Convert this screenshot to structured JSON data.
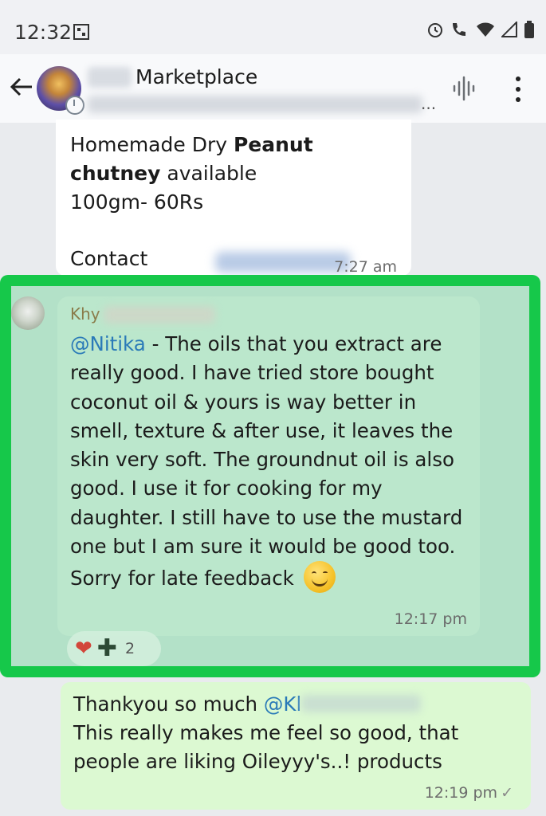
{
  "status_bar": {
    "time": "12:32",
    "icons": [
      "alarm-icon",
      "wifi-call-icon",
      "wifi-icon",
      "signal-icon",
      "battery-icon"
    ]
  },
  "header": {
    "title_partial": "Marketplace",
    "subtitle_ellipsis": "..."
  },
  "messages": [
    {
      "id": "msg1",
      "text_pre_bold": "Homemade Dry ",
      "text_bold1": "Peanut",
      "text_bold2": "chutney",
      "text_post_bold": " available",
      "line3": "100gm- 60Rs",
      "contact_label": "Contact",
      "time": "7:27 am"
    },
    {
      "id": "msg2",
      "sender_partial": "Khy",
      "mention": "@Nitika",
      "text": " - The oils that you extract are really good. I have tried store bought coconut oil & yours is way better in smell, texture & after use, it leaves the skin very soft. The groundnut oil is also good. I use it for cooking for my daughter. I still have to use the mustard one but I am sure it would be good too. Sorry for late feedback",
      "time": "12:17 pm",
      "reactions": {
        "heart": "❤",
        "plus": "✚",
        "count": "2"
      }
    },
    {
      "id": "msg3",
      "line1_pre": "Thankyou so much ",
      "mention_partial": "@Kl",
      "line2": "This really makes me feel so good, that people are liking Oileyyy's..! products",
      "time": "12:19 pm",
      "tick": "✓"
    }
  ],
  "colors": {
    "highlight_border": "#16c84a",
    "mention": "#2a7ab8",
    "outgoing_bubble": "#dcf9d2"
  }
}
